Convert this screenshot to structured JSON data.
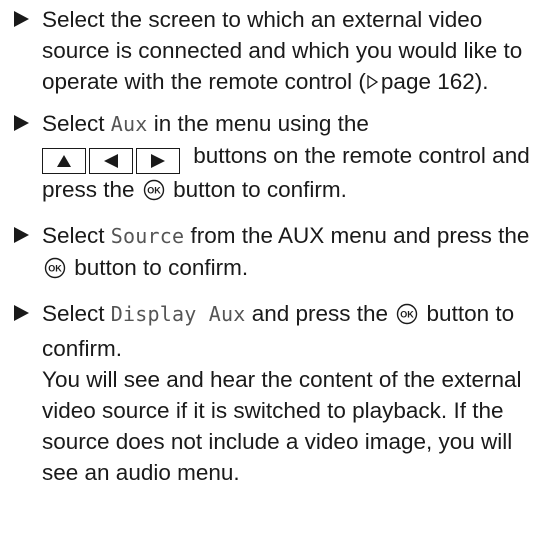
{
  "steps": [
    {
      "text_before": "Select the screen to which an external video source is connected and which you would like to operate with the remote control (",
      "page_ref": "page 162",
      "text_after": ")."
    },
    {
      "text_a": "Select ",
      "code": "Aux",
      "text_b": " in the menu using the",
      "text_c": " buttons on the remote control and press the ",
      "text_d": " button to confirm."
    },
    {
      "text_a": "Select ",
      "code": "Source",
      "text_b": " from the AUX menu and press the ",
      "text_c": " button to confirm."
    },
    {
      "text_a": "Select ",
      "code": "Display Aux",
      "text_b": " and press the ",
      "text_c": " button to confirm.",
      "note": "You will see and hear the content of the external video source if it is switched to playback. If the source does not include a video image, you will see an audio menu."
    }
  ],
  "buttons": {
    "ok_label": "OK",
    "keys": [
      "up-arrow-icon",
      "left-arrow-icon",
      "right-arrow-icon"
    ]
  }
}
